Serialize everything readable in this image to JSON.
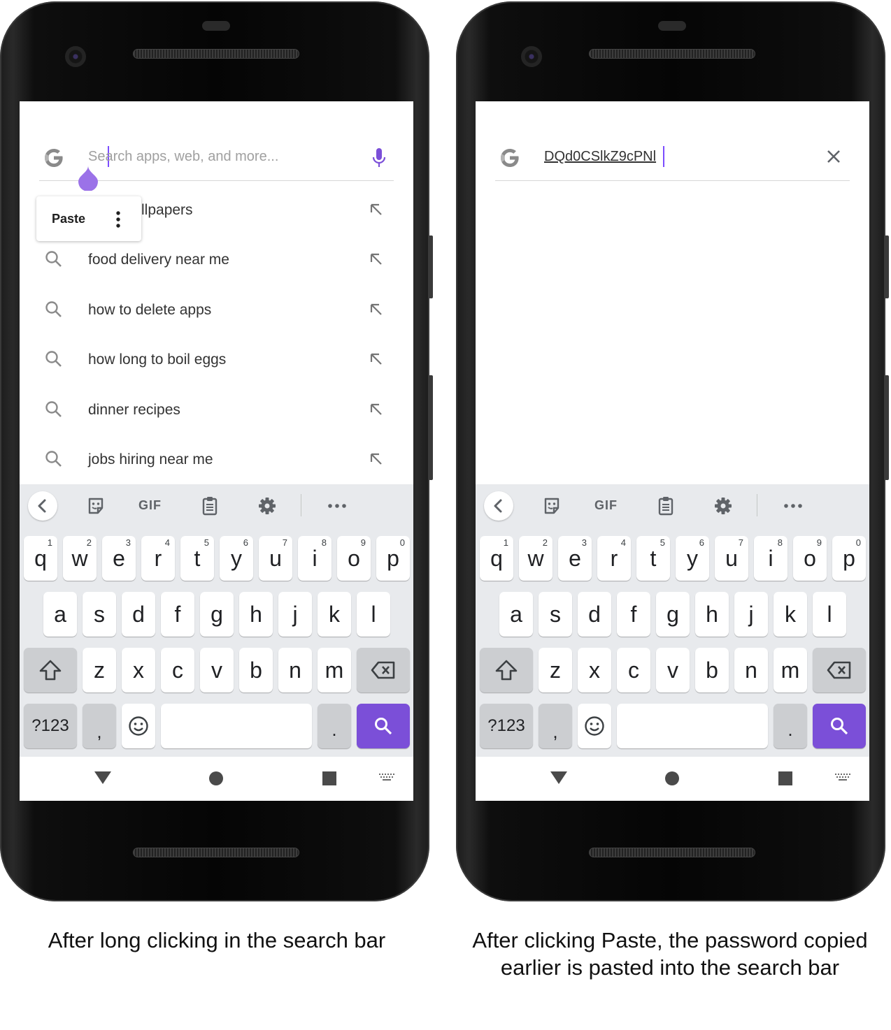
{
  "left_phone": {
    "search_placeholder": "Search apps, web, and more...",
    "paste_menu": {
      "paste_label": "Paste"
    },
    "partial_suggestion": "llpapers",
    "suggestions": [
      "food delivery near me",
      "how to delete apps",
      "how long to boil eggs",
      "dinner recipes",
      "jobs hiring near me"
    ]
  },
  "right_phone": {
    "search_value": "DQd0CSlkZ9cPNl"
  },
  "keyboard": {
    "toolbar": {
      "gif_label": "GIF"
    },
    "row1": [
      {
        "k": "q",
        "n": "1"
      },
      {
        "k": "w",
        "n": "2"
      },
      {
        "k": "e",
        "n": "3"
      },
      {
        "k": "r",
        "n": "4"
      },
      {
        "k": "t",
        "n": "5"
      },
      {
        "k": "y",
        "n": "6"
      },
      {
        "k": "u",
        "n": "7"
      },
      {
        "k": "i",
        "n": "8"
      },
      {
        "k": "o",
        "n": "9"
      },
      {
        "k": "p",
        "n": "0"
      }
    ],
    "row2": [
      "a",
      "s",
      "d",
      "f",
      "g",
      "h",
      "j",
      "k",
      "l"
    ],
    "row3": [
      "z",
      "x",
      "c",
      "v",
      "b",
      "n",
      "m"
    ],
    "symbols_label": "?123",
    "comma": ",",
    "period": "."
  },
  "colors": {
    "accent": "#7b4fd8",
    "caret": "#7c4dff",
    "keyboard_bg": "#e8eaed"
  },
  "captions": {
    "left": "After long clicking in the search bar",
    "right": "After clicking Paste, the password copied earlier is pasted into the search bar"
  }
}
